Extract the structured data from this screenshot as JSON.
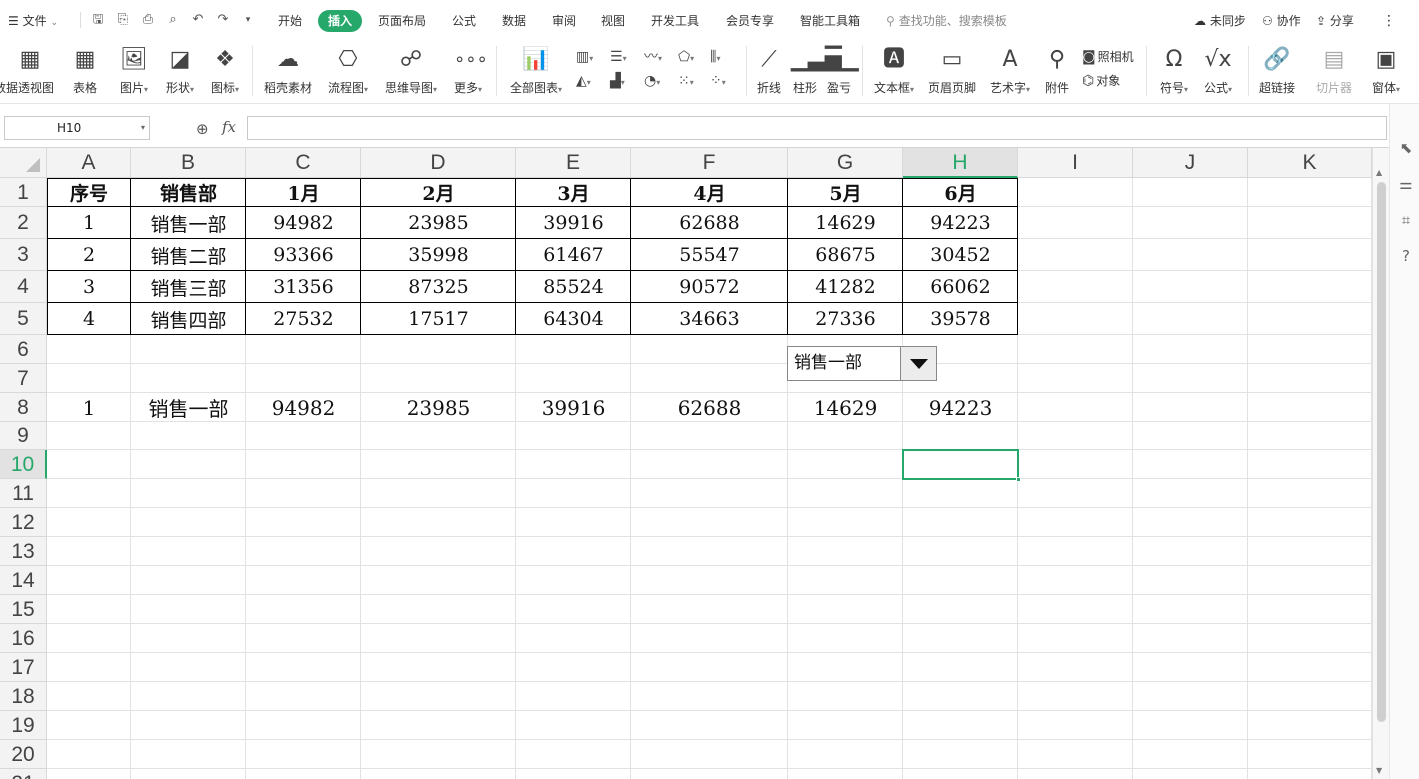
{
  "menu": {
    "file": "文件",
    "tabs": [
      "开始",
      "插入",
      "页面布局",
      "公式",
      "数据",
      "审阅",
      "视图",
      "开发工具",
      "会员专享",
      "智能工具箱"
    ],
    "active_tab": "插入",
    "search_placeholder": "查找功能、搜索模板",
    "sync": "未同步",
    "collab": "协作",
    "share": "分享"
  },
  "ribbon": {
    "pivot": "数据透视图",
    "table": "表格",
    "picture": "图片",
    "shape": "形状",
    "icon": "图标",
    "material": "稻壳素材",
    "flowchart": "流程图",
    "mindmap": "思维导图",
    "more": "更多",
    "all_charts": "全部图表",
    "spark_line": "折线",
    "spark_column": "柱形",
    "spark_winloss": "盈亏",
    "textbox": "文本框",
    "header_footer": "页眉页脚",
    "wordart": "艺术字",
    "attachment": "附件",
    "camera": "照相机",
    "object": "对象",
    "symbol": "符号",
    "formula": "公式",
    "hyperlink": "超链接",
    "slicer": "切片器",
    "window": "窗体"
  },
  "formula_bar": {
    "name_box": "H10",
    "formula": ""
  },
  "sheet": {
    "columns": [
      "A",
      "B",
      "C",
      "D",
      "E",
      "F",
      "G",
      "H",
      "I",
      "J",
      "K"
    ],
    "rows": [
      "1",
      "2",
      "3",
      "4",
      "5",
      "6",
      "7",
      "8",
      "9",
      "10",
      "11",
      "12",
      "13",
      "14",
      "15",
      "16",
      "17",
      "18",
      "19",
      "20",
      "21"
    ],
    "active_cell": "H10",
    "table_header": [
      "序号",
      "销售部",
      "1月",
      "2月",
      "3月",
      "4月",
      "5月",
      "6月"
    ],
    "table_rows": [
      [
        "1",
        "销售一部",
        "94982",
        "23985",
        "39916",
        "62688",
        "14629",
        "94223"
      ],
      [
        "2",
        "销售二部",
        "93366",
        "35998",
        "61467",
        "55547",
        "68675",
        "30452"
      ],
      [
        "3",
        "销售三部",
        "31356",
        "87325",
        "85524",
        "90572",
        "41282",
        "66062"
      ],
      [
        "4",
        "销售四部",
        "27532",
        "17517",
        "64304",
        "34663",
        "27336",
        "39578"
      ]
    ],
    "result_row": [
      "1",
      "销售一部",
      "94982",
      "23985",
      "39916",
      "62688",
      "14629",
      "94223"
    ],
    "combo_value": "销售一部"
  }
}
